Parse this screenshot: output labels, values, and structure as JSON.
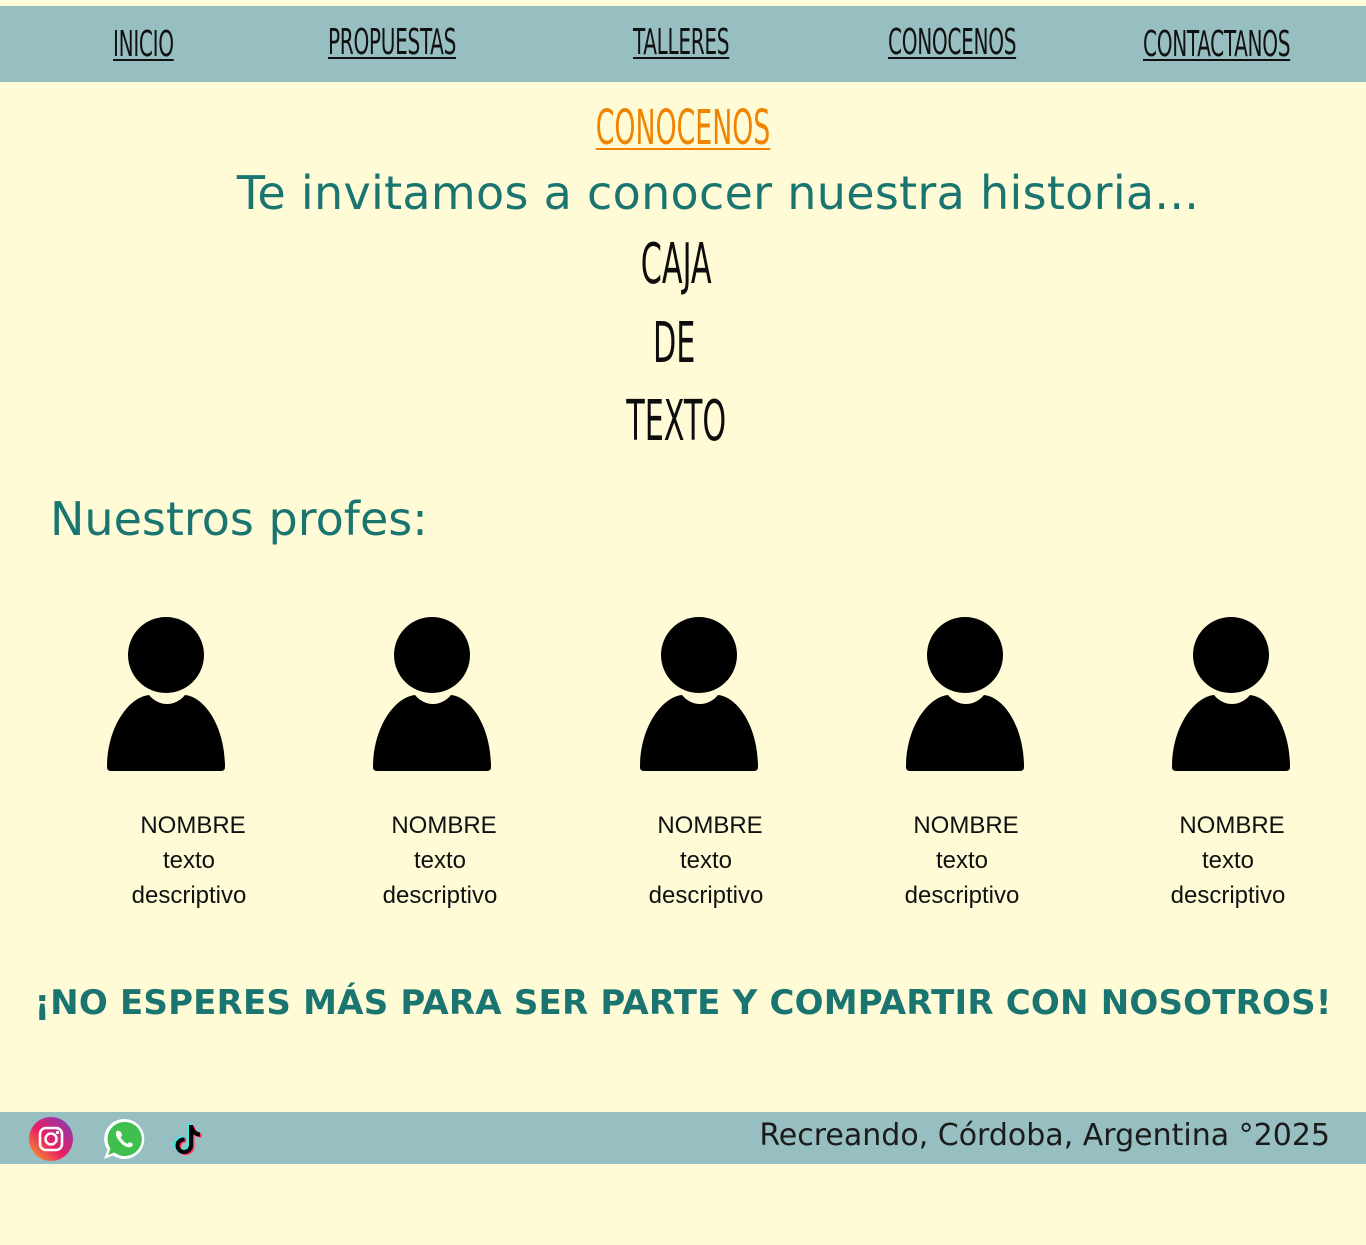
{
  "nav": {
    "items": [
      {
        "label": "INICIO"
      },
      {
        "label": "PROPUESTAS"
      },
      {
        "label": "TALLERES"
      },
      {
        "label": "CONOCENOS"
      },
      {
        "label": "CONTACTANOS"
      }
    ]
  },
  "main": {
    "section_title": "CONOCENOS",
    "subtitle": "Te invitamos a conocer nuestra historia...",
    "text_box": [
      "CAJA",
      "DE",
      "TEXTO"
    ],
    "profes_title": "Nuestros profes:",
    "profes": [
      {
        "name": "NOMBRE",
        "line1": "texto",
        "line2": "descriptivo"
      },
      {
        "name": "NOMBRE",
        "line1": "texto",
        "line2": "descriptivo"
      },
      {
        "name": "NOMBRE",
        "line1": "texto",
        "line2": "descriptivo"
      },
      {
        "name": "NOMBRE",
        "line1": "texto",
        "line2": "descriptivo"
      },
      {
        "name": "NOMBRE",
        "line1": "texto",
        "line2": "descriptivo"
      }
    ],
    "cta": "¡NO ESPERES MÁS PARA SER PARTE Y COMPARTIR CON NOSOTROS!"
  },
  "footer": {
    "social_icons": [
      "instagram-icon",
      "whatsapp-icon",
      "tiktok-icon"
    ],
    "text": "Recreando, Córdoba, Argentina °2025"
  },
  "colors": {
    "background": "#fefbd6",
    "bars": "#97bfc1",
    "accent_orange": "#f08300",
    "teal_text": "#1a7570"
  }
}
